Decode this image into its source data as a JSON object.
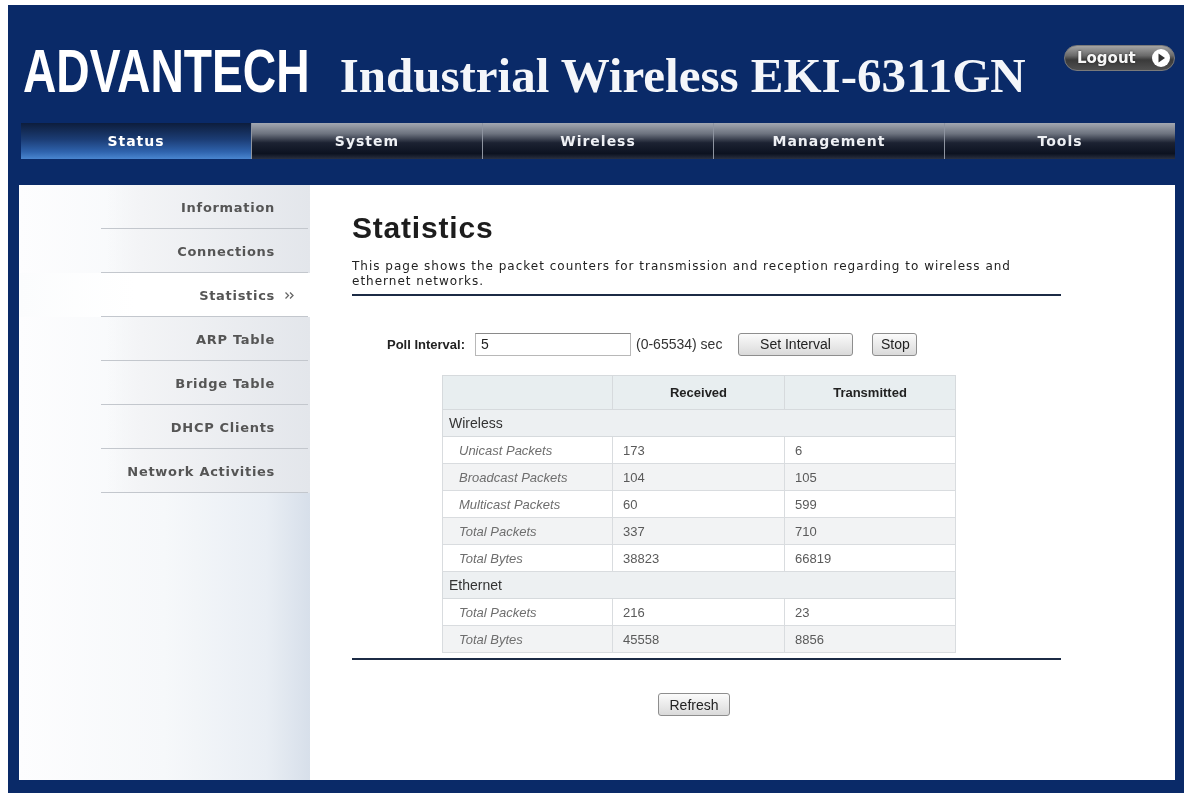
{
  "header": {
    "logo": "ADVANTECH",
    "title": "Industrial Wireless EKI-6311GN",
    "logout_button": "Logout"
  },
  "nav_tabs": [
    {
      "label": "Status",
      "selected": true
    },
    {
      "label": "System",
      "selected": false
    },
    {
      "label": "Wireless",
      "selected": false
    },
    {
      "label": "Management",
      "selected": false
    },
    {
      "label": "Tools",
      "selected": false
    }
  ],
  "sidebar": {
    "items": [
      {
        "label": "Information",
        "selected": false
      },
      {
        "label": "Connections",
        "selected": false
      },
      {
        "label": "Statistics",
        "selected": true
      },
      {
        "label": "ARP Table",
        "selected": false
      },
      {
        "label": "Bridge Table",
        "selected": false
      },
      {
        "label": "DHCP Clients",
        "selected": false
      },
      {
        "label": "Network Activities",
        "selected": false
      }
    ]
  },
  "content": {
    "title": "Statistics",
    "description": "This page shows the packet counters for transmission and reception regarding to wireless and ethernet networks.",
    "poll_interval": {
      "label": "Poll Interval:",
      "value": "5",
      "range": "(0-65534) sec",
      "set_button": "Set Interval",
      "stop_button": "Stop"
    },
    "table": {
      "columns": [
        "Received",
        "Transmitted"
      ],
      "sections": [
        {
          "name": "Wireless",
          "rows": [
            {
              "label": "Unicast Packets",
              "values": [
                "173",
                "6"
              ]
            },
            {
              "label": "Broadcast Packets",
              "values": [
                "104",
                "105"
              ]
            },
            {
              "label": "Multicast Packets",
              "values": [
                "60",
                "599"
              ]
            },
            {
              "label": "Total Packets",
              "values": [
                "337",
                "710"
              ]
            },
            {
              "label": "Total Bytes",
              "values": [
                "38823",
                "66819"
              ]
            }
          ]
        },
        {
          "name": "Ethernet",
          "rows": [
            {
              "label": "Total Packets",
              "values": [
                "216",
                "23"
              ]
            },
            {
              "label": "Total Bytes",
              "values": [
                "45558",
                "8856"
              ]
            }
          ]
        }
      ]
    },
    "refresh_button": "Refresh"
  }
}
